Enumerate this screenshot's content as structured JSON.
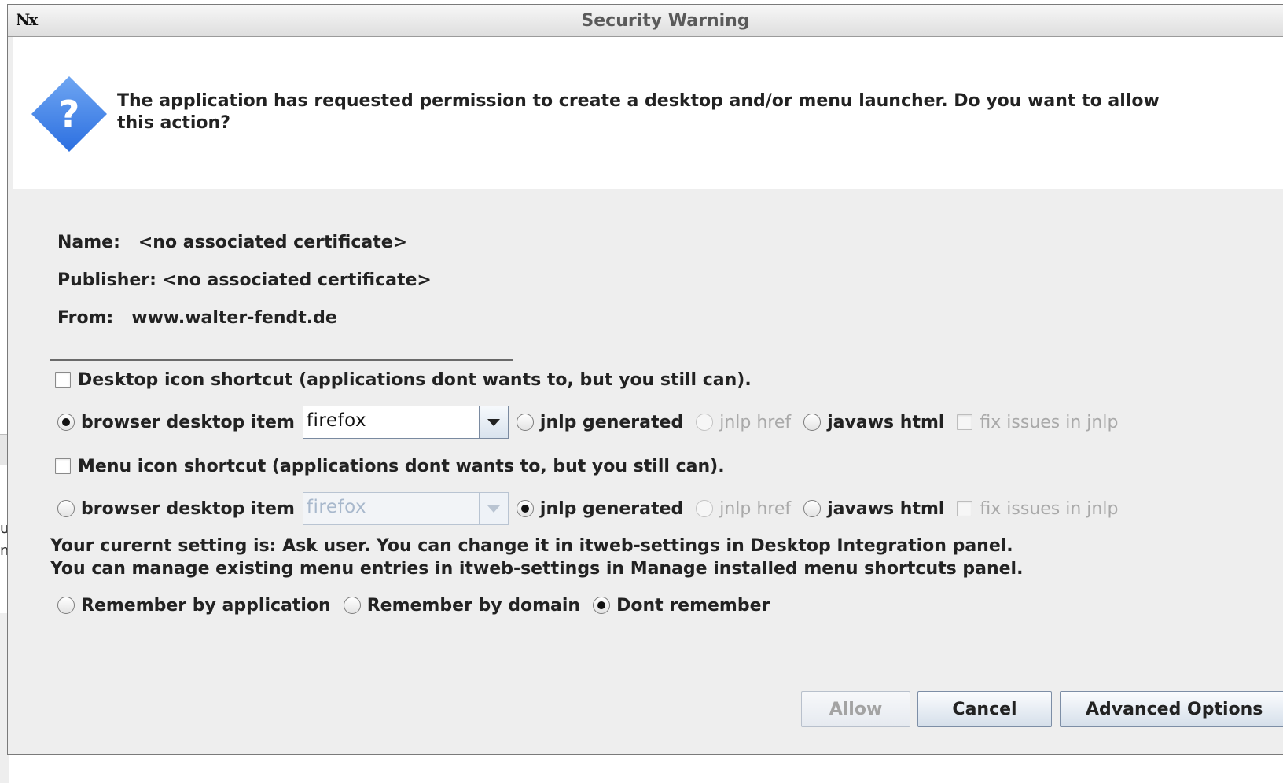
{
  "window": {
    "title": "Security Warning",
    "logo": "Nx",
    "icon": "question-icon"
  },
  "banner": {
    "message": "The application has requested permission to create a desktop and/or menu launcher. Do you want to allow\nthis action?"
  },
  "info": {
    "name": "Name:   <no associated certificate>",
    "publisher": "Publisher: <no associated certificate>",
    "from": "From:   www.walter-fendt.de"
  },
  "desktop": {
    "checkbox_label": "Desktop icon shortcut (applications dont wants to, but you still can).",
    "checked": false,
    "browser_label": "browser desktop item",
    "browser_value": "firefox",
    "jnlp_generated": "jnlp generated",
    "jnlp_href": "jnlp href",
    "javaws_html": "javaws html",
    "fix_issues": "fix issues in jnlp",
    "selected": "browser desktop item"
  },
  "menu": {
    "checkbox_label": "Menu icon shortcut (applications dont wants to, but you still can).",
    "checked": false,
    "browser_label": "browser desktop item",
    "browser_value": "firefox",
    "jnlp_generated": "jnlp generated",
    "jnlp_href": "jnlp href",
    "javaws_html": "javaws html",
    "fix_issues": "fix issues in jnlp",
    "selected": "jnlp generated"
  },
  "notes": {
    "line1": "Your curernt setting is: Ask user. You can change it in itweb-settings in Desktop Integration panel.",
    "line2": "You can manage existing menu entries in itweb-settings in Manage installed menu shortcuts panel."
  },
  "remember": {
    "by_application": "Remember by application",
    "by_domain": "Remember by domain",
    "dont_remember": "Dont remember",
    "selected": "Dont remember"
  },
  "buttons": {
    "allow": "Allow",
    "cancel": "Cancel",
    "advanced": "Advanced Options"
  },
  "background": {
    "char1": "u",
    "char2": "n"
  }
}
